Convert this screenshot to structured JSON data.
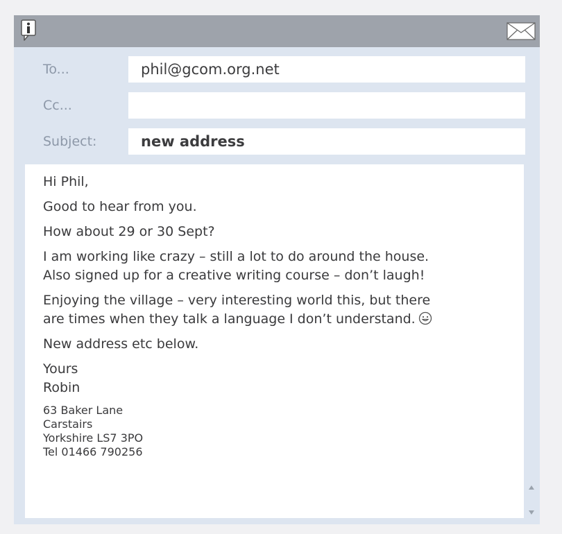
{
  "header": {
    "info_icon": "info-icon",
    "mail_icon": "envelope-icon"
  },
  "fields": {
    "to_label": "To...",
    "to_value": "phil@gcom.org.net",
    "cc_label": "Cc...",
    "cc_value": "",
    "subject_label": "Subject:",
    "subject_value": "new address"
  },
  "message": {
    "paragraphs": [
      "Hi Phil,",
      "Good to hear from you.",
      "How about 29 or 30 Sept?",
      "I am working like crazy – still a lot to do around the house.\nAlso signed up for a creative writing course – don’t laugh!",
      "Enjoying the village – very interesting world this, but there\nare times when they talk a language I don’t understand.",
      "New address etc below.",
      "Yours\nRobin"
    ],
    "address": {
      "line1": "63 Baker Lane",
      "line2": "Carstairs",
      "line3": "Yorkshire LS7 3PO",
      "line4": "Tel 01466 790256"
    },
    "emoticon": "smiley-icon"
  },
  "colors": {
    "window_bg": "#dde5f0",
    "titlebar": "#9ea3ab",
    "label": "#8d98a8",
    "text": "#3a3a3c"
  }
}
